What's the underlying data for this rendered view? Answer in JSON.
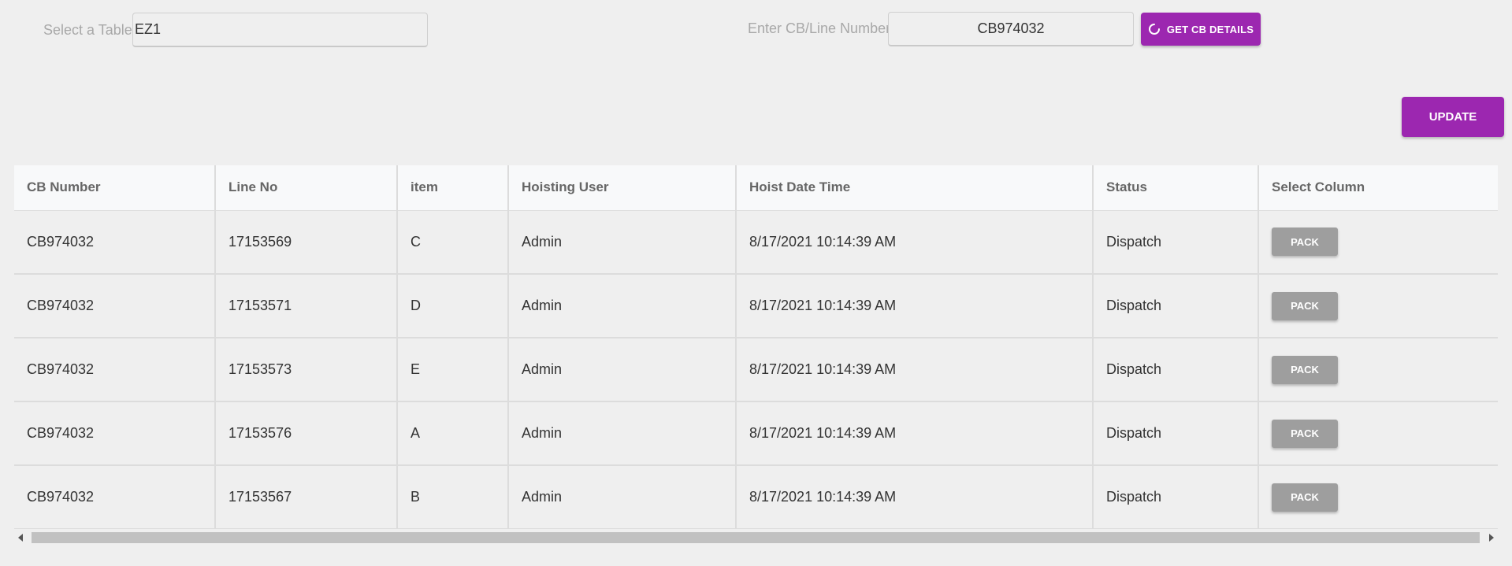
{
  "table_select": {
    "label": "Select a Table",
    "value": "EZ1"
  },
  "cb_lookup": {
    "label": "Enter CB/Line Number:",
    "value": "CB974032",
    "button_label": "GET CB DETAILS"
  },
  "update_button_label": "UPDATE",
  "colors": {
    "accent": "#9c27b0",
    "pack_button": "#9e9e9e",
    "background": "#efefef",
    "header_background": "#f8f9fa"
  },
  "grid": {
    "columns": [
      "CB Number",
      "Line No",
      "item",
      "Hoisting User",
      "Hoist Date Time",
      "Status",
      "Select Column"
    ],
    "rows": [
      {
        "cb_number": "CB974032",
        "line_no": "17153569",
        "item": "C",
        "user": "Admin",
        "datetime": "8/17/2021 10:14:39 AM",
        "status": "Dispatch",
        "action": "PACK"
      },
      {
        "cb_number": "CB974032",
        "line_no": "17153571",
        "item": "D",
        "user": "Admin",
        "datetime": "8/17/2021 10:14:39 AM",
        "status": "Dispatch",
        "action": "PACK"
      },
      {
        "cb_number": "CB974032",
        "line_no": "17153573",
        "item": "E",
        "user": "Admin",
        "datetime": "8/17/2021 10:14:39 AM",
        "status": "Dispatch",
        "action": "PACK"
      },
      {
        "cb_number": "CB974032",
        "line_no": "17153576",
        "item": "A",
        "user": "Admin",
        "datetime": "8/17/2021 10:14:39 AM",
        "status": "Dispatch",
        "action": "PACK"
      },
      {
        "cb_number": "CB974032",
        "line_no": "17153567",
        "item": "B",
        "user": "Admin",
        "datetime": "8/17/2021 10:14:39 AM",
        "status": "Dispatch",
        "action": "PACK"
      }
    ]
  }
}
